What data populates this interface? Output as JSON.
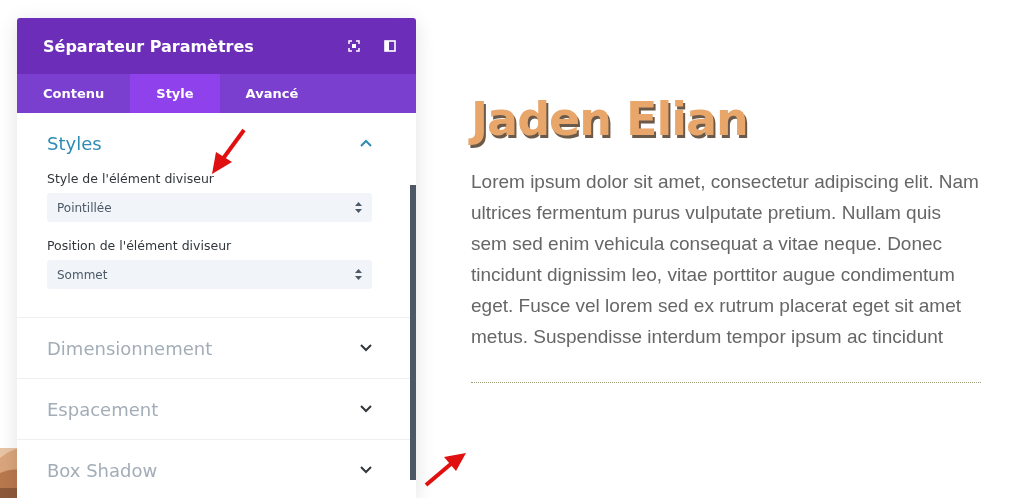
{
  "panel": {
    "title": "Séparateur Paramètres",
    "tabs": [
      {
        "label": "Contenu",
        "selected": false
      },
      {
        "label": "Style",
        "selected": true
      },
      {
        "label": "Avancé",
        "selected": false
      }
    ],
    "sections": [
      {
        "title": "Styles",
        "expanded": true,
        "fields": [
          {
            "label": "Style de l'élément diviseur",
            "value": "Pointillée"
          },
          {
            "label": "Position de l'élément diviseur",
            "value": "Sommet"
          }
        ]
      },
      {
        "title": "Dimensionnement",
        "expanded": false
      },
      {
        "title": "Espacement",
        "expanded": false
      },
      {
        "title": "Box Shadow",
        "expanded": false
      }
    ]
  },
  "preview": {
    "heading": "Jaden Elian",
    "body": "Lorem ipsum dolor sit amet, consectetur adipiscing elit. Nam ultrices fermentum purus vulputate pretium. Nullam quis sem sed enim vehicula consequat a vitae neque. Donec tincidunt dignissim leo, vitae porttitor augue condimentum eget. Fusce vel lorem sed ex rutrum placerat eget sit amet metus. Suspendisse interdum tempor ipsum ac tincidunt"
  }
}
